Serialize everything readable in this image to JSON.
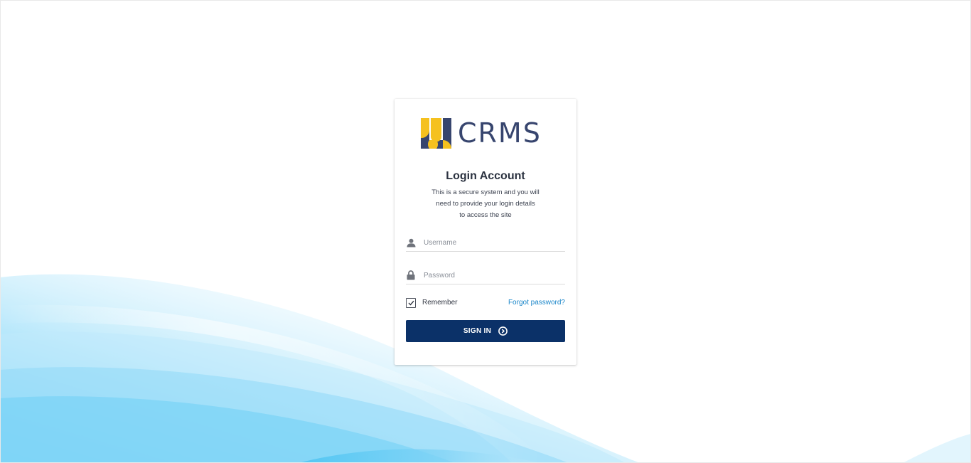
{
  "brand": {
    "name": "CRMS",
    "logo_icon": "crms-logo-icon",
    "logo_colors": {
      "yellow": "#f5c11f",
      "navy": "#37456e"
    }
  },
  "login": {
    "title": "Login Account",
    "subtitle_lines": [
      "This is a secure system and you will",
      "need to provide your login details",
      "to access the site"
    ],
    "username": {
      "placeholder": "Username",
      "value": "",
      "icon": "user-icon"
    },
    "password": {
      "placeholder": "Password",
      "value": "",
      "icon": "lock-icon"
    },
    "remember": {
      "label": "Remember",
      "checked": true
    },
    "forgot_label": "Forgot password?",
    "signin_label": "SIGN IN",
    "signin_icon": "arrow-circle-right-icon"
  },
  "colors": {
    "primary": "#0b3168",
    "link": "#1a86c9",
    "wave_light": "#bfe9fb",
    "wave_mid": "#7fd3f6",
    "wave_dark": "#4cc4f2"
  }
}
